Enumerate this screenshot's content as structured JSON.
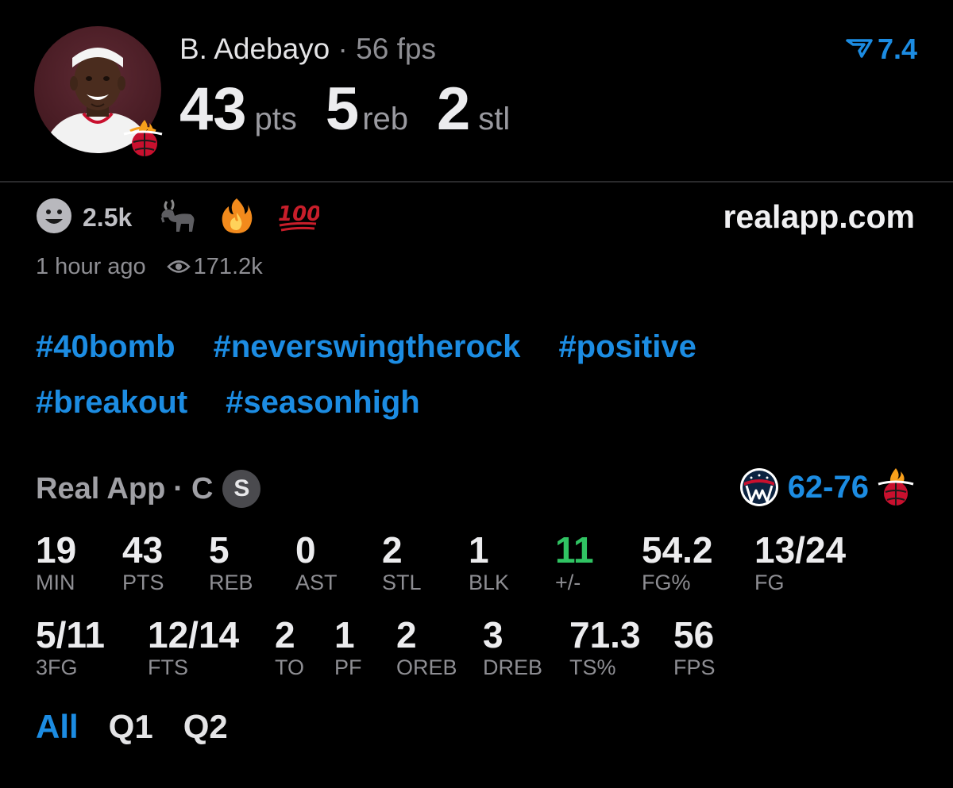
{
  "player": {
    "name": "B. Adebayo",
    "separator": "·",
    "fps_label": "56 fps",
    "avatar_team_icon": "heat-logo-icon"
  },
  "rating": {
    "icon": "rating-chevron-icon",
    "value": "7.4"
  },
  "headline_stats": [
    {
      "value": "43",
      "unit": "pts"
    },
    {
      "value": "5",
      "unit": "reb"
    },
    {
      "value": "2",
      "unit": "stl"
    }
  ],
  "reactions": {
    "count": "2.5k",
    "items": [
      "smiley-icon",
      "goat-icon",
      "fire-icon",
      "hundred-icon"
    ]
  },
  "site": "realapp.com",
  "meta": {
    "time": "1 hour ago",
    "views": "171.2k"
  },
  "hashtags": {
    "row1": [
      "#40bomb",
      "#neverswingtherock",
      "#positive"
    ],
    "row2": [
      "#breakout",
      "#seasonhigh"
    ]
  },
  "box": {
    "source": "Real App",
    "separator": "·",
    "position": "C",
    "badge": "S",
    "score": "62-76",
    "away_team_icon": "wizards-logo-icon",
    "home_team_icon": "heat-logo-icon",
    "row1": [
      {
        "value": "19",
        "label": "MIN"
      },
      {
        "value": "43",
        "label": "PTS"
      },
      {
        "value": "5",
        "label": "REB"
      },
      {
        "value": "0",
        "label": "AST"
      },
      {
        "value": "2",
        "label": "STL"
      },
      {
        "value": "1",
        "label": "BLK"
      },
      {
        "value": "11",
        "label": "+/-"
      },
      {
        "value": "54.2",
        "label": "FG%"
      },
      {
        "value": "13/24",
        "label": "FG"
      }
    ],
    "row2": [
      {
        "value": "5/11",
        "label": "3FG"
      },
      {
        "value": "12/14",
        "label": "FTS"
      },
      {
        "value": "2",
        "label": "TO"
      },
      {
        "value": "1",
        "label": "PF"
      },
      {
        "value": "2",
        "label": "OREB"
      },
      {
        "value": "3",
        "label": "DREB"
      },
      {
        "value": "71.3",
        "label": "TS%"
      },
      {
        "value": "56",
        "label": "FPS"
      }
    ]
  },
  "tabs": [
    {
      "label": "All",
      "active": true
    },
    {
      "label": "Q1",
      "active": false
    },
    {
      "label": "Q2",
      "active": false
    }
  ],
  "colors": {
    "accent": "#1c8ce2",
    "positive": "#30c463",
    "heat_red": "#c8102e",
    "wizards_navy": "#0c2340"
  }
}
